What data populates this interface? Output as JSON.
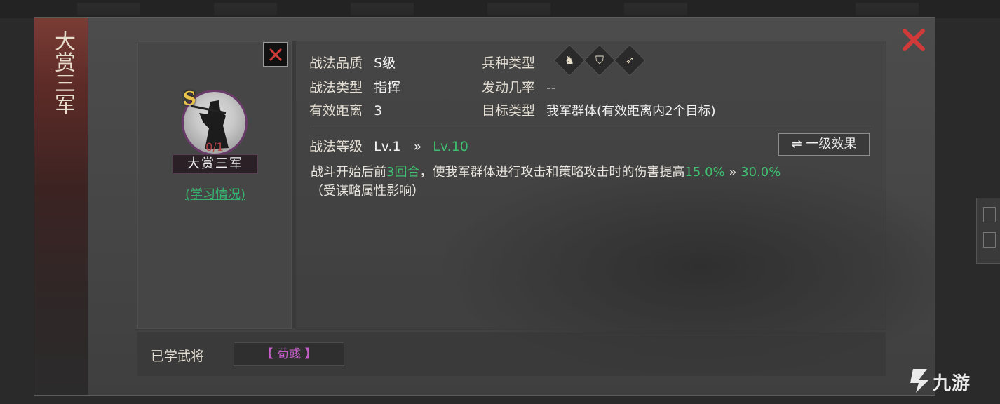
{
  "skill": {
    "title": "大赏三军",
    "grade_letter": "S",
    "learn_count": "0/1",
    "name_plate": "大赏三军",
    "study_link": "(学习情况)"
  },
  "info": {
    "quality_label": "战法品质",
    "quality_value": "S级",
    "unit_type_label": "兵种类型",
    "skill_type_label": "战法类型",
    "skill_type_value": "指挥",
    "trigger_rate_label": "发动几率",
    "trigger_rate_value": "--",
    "range_label": "有效距离",
    "range_value": "3",
    "target_label": "目标类型",
    "target_value": "我军群体(有效距离内2个目标)",
    "unit_icons": [
      "cavalry-icon",
      "shield-icon",
      "bow-icon"
    ]
  },
  "level": {
    "label": "战法等级",
    "current": "Lv.1",
    "arrow": "»",
    "max": "Lv.10",
    "effect_button": "⇌ 一级效果"
  },
  "description": {
    "part1": "战斗开始后前",
    "rounds": "3回合",
    "part2": "，使我军群体进行攻击和策略攻击时的伤害提高",
    "value_from": "15.0%",
    "arrow": "»",
    "value_to": "30.0%",
    "note": "（受谋略属性影响）"
  },
  "learned": {
    "label": "已学武将",
    "general": "【 荀彧 】"
  },
  "watermark": "九游",
  "colors": {
    "green": "#3fbf6f",
    "close_red": "#d23a3a",
    "purple": "#c45fc9"
  }
}
